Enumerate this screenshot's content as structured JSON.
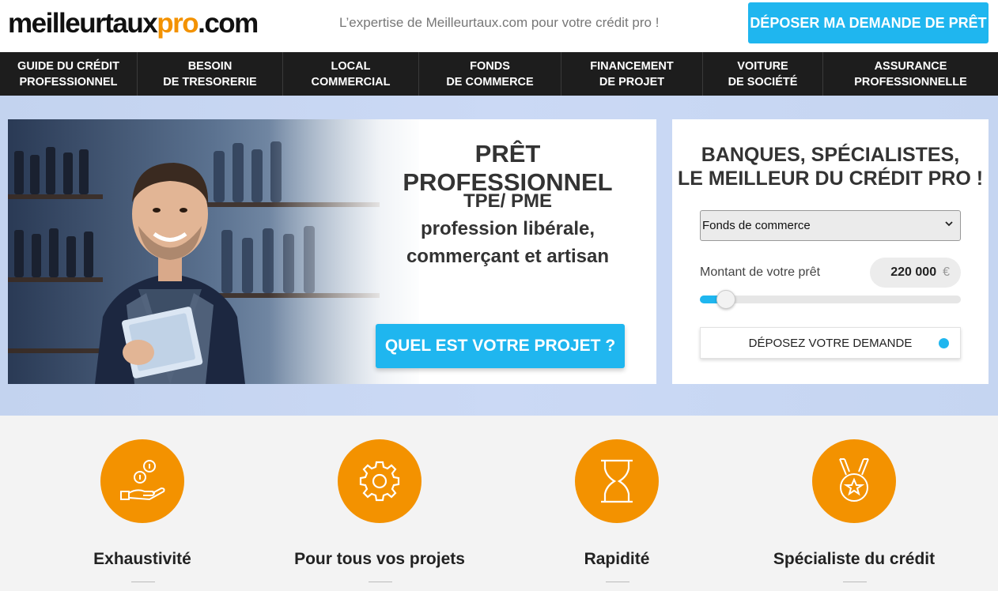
{
  "header": {
    "logo_part1": "meilleurtaux",
    "logo_part2": "pro",
    "logo_part3": ".com",
    "tagline": "L’expertise de Meilleurtaux.com pour votre crédit pro !",
    "cta": "DÉPOSER MA DEMANDE DE PRÊT"
  },
  "nav": {
    "items": [
      {
        "label": "GUIDE DU CRÉDIT\nPROFESSIONNEL"
      },
      {
        "label": "BESOIN\nDE TRESORERIE"
      },
      {
        "label": "LOCAL\nCOMMERCIAL"
      },
      {
        "label": "FONDS\nDE COMMERCE"
      },
      {
        "label": "FINANCEMENT\nDE PROJET"
      },
      {
        "label": "VOITURE\nDE SOCIÉTÉ"
      },
      {
        "label": "ASSURANCE\nPROFESSIONNELLE"
      }
    ]
  },
  "hero": {
    "title": "PRÊT PROFESSIONNEL",
    "subtitle_line1": "TPE/ PME",
    "subtitle_line2": "profession libérale,",
    "subtitle_line3": "commerçant et artisan",
    "button": "QUEL EST VOTRE PROJET ?"
  },
  "form": {
    "title_line1": "BANQUES, SPÉCIALISTES,",
    "title_line2": "LE MEILLEUR DU CRÉDIT PRO !",
    "select_value": "Fonds de commerce",
    "amount_label": "Montant de votre prêt",
    "amount_value": "220 000",
    "currency": "€",
    "slider_fraction": 0.1,
    "submit": "DÉPOSEZ VOTRE DEMANDE"
  },
  "features": [
    {
      "title": "Exhaustivité",
      "icon": "hand-coins-icon"
    },
    {
      "title": "Pour tous vos projets",
      "icon": "gear-icon"
    },
    {
      "title": "Rapidité",
      "icon": "hourglass-icon"
    },
    {
      "title": "Spécialiste du crédit",
      "icon": "medal-icon"
    }
  ],
  "colors": {
    "accent_blue": "#1fb6ef",
    "accent_orange": "#f39200",
    "nav_bg": "#1d1d1d"
  }
}
